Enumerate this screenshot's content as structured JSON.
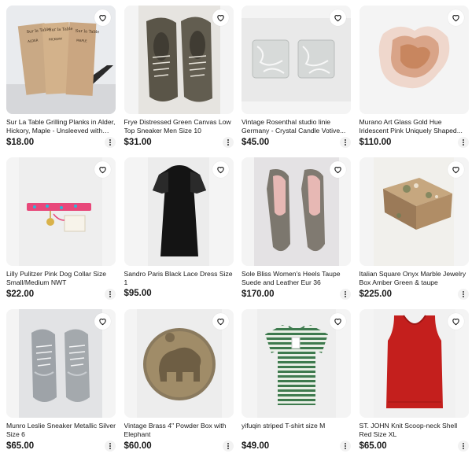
{
  "icons": {
    "favorite": "heart-outline-icon",
    "more": "more-vertical-icon"
  },
  "listings": [
    {
      "title": "Sur La Table Grilling Planks in Alder, Hickory, Maple - Unsleeved with Tray",
      "price": "$18.00",
      "image_text": [
        "Sur la Table",
        "ALDER",
        "HICKORY",
        "MAPLE"
      ]
    },
    {
      "title": "Frye Distressed Green Canvas Low Top Sneaker Men Size 10",
      "price": "$31.00"
    },
    {
      "title": "Vintage Rosenthal studio linie Germany - Crystal Candle Votive...",
      "price": "$45.00"
    },
    {
      "title": "Murano Art Glass Gold Hue Iridescent Pink Uniquely Shaped...",
      "price": "$110.00"
    },
    {
      "title": "Lilly Pulitzer Pink Dog Collar Size Small/Medium NWT",
      "price": "$22.00"
    },
    {
      "title": "Sandro Paris Black Lace Dress Size 1",
      "price": "$95.00"
    },
    {
      "title": "Sole Bliss Women's Heels Taupe Suede and Leather Eur 36",
      "price": "$170.00"
    },
    {
      "title": "Italian Square Onyx Marble Jewelry Box Amber Green & taupe",
      "price": "$225.00"
    },
    {
      "title": "Munro Leslie Sneaker Metallic Silver Size 6",
      "price": "$65.00"
    },
    {
      "title": "Vintage Brass 4\" Powder Box with Elephant",
      "price": "$60.00"
    },
    {
      "title": "yifuqin striped T-shirt size M",
      "price": "$49.00"
    },
    {
      "title": "ST. JOHN Knit Scoop-neck Shell Red Size XL",
      "price": "$65.00"
    }
  ]
}
